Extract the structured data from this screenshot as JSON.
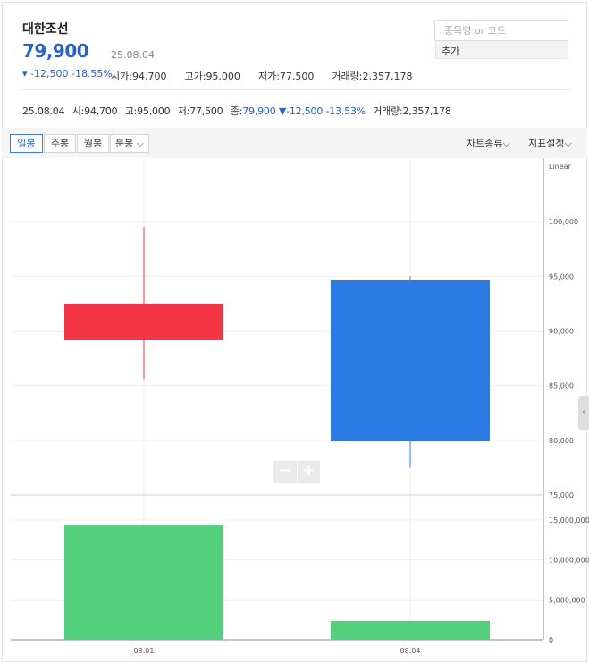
{
  "stock": {
    "name": "대한조선",
    "price": "79,900",
    "date": "25.08.04",
    "change": "▾ -12,500 -18.55%",
    "stats": [
      {
        "label": "시가",
        "value": "94,700"
      },
      {
        "label": "고가",
        "value": "95,000"
      },
      {
        "label": "저가",
        "value": "77,500"
      },
      {
        "label": "거래량",
        "value": "2,357,178"
      }
    ]
  },
  "search": {
    "placeholder": "종목명 or 코드",
    "add_label": "추가"
  },
  "ohlc_line": {
    "date": "25.08.04",
    "open_label": "시",
    "open": "94,700",
    "high_label": "고",
    "high": "95,000",
    "low_label": "저",
    "low": "77,500",
    "close_label": "종",
    "close": "79,900",
    "change": "▼-12,500 -13.53%",
    "volume_label": "거래량",
    "volume": "2,357,178"
  },
  "toolbar": {
    "tabs": [
      "일봉",
      "주봉",
      "월봉",
      "분봉"
    ],
    "active_tab": "일봉",
    "chart_type": "차트종류",
    "indicator": "지표설정"
  },
  "colors": {
    "up": "#f23645",
    "down": "#2c7be5",
    "volume": "#52d07c",
    "accent": "#2a62c8"
  },
  "chart_data": [
    {
      "type": "candlestick",
      "scale_label": "Linear",
      "categories": [
        "08.01",
        "08.04"
      ],
      "candles": [
        {
          "x": "08.01",
          "open": 89200,
          "close": 92500,
          "high": 99500,
          "low": 85600
        },
        {
          "x": "08.04",
          "open": 94700,
          "close": 79900,
          "high": 95000,
          "low": 77500
        }
      ],
      "ylim": [
        75000,
        105000
      ],
      "yticks": [
        75000,
        80000,
        85000,
        90000,
        95000,
        100000
      ],
      "ytick_labels": [
        "75,000",
        "80,000",
        "85,000",
        "90,000",
        "95,000",
        "100,000"
      ]
    },
    {
      "type": "bar",
      "categories": [
        "08.01",
        "08.04"
      ],
      "values": [
        14300000,
        2357178
      ],
      "ylim": [
        0,
        18000000
      ],
      "yticks": [
        0,
        5000000,
        10000000,
        15000000
      ],
      "ytick_labels": [
        "0",
        "5,000,000",
        "10,000,000",
        "15,000,000"
      ]
    }
  ]
}
